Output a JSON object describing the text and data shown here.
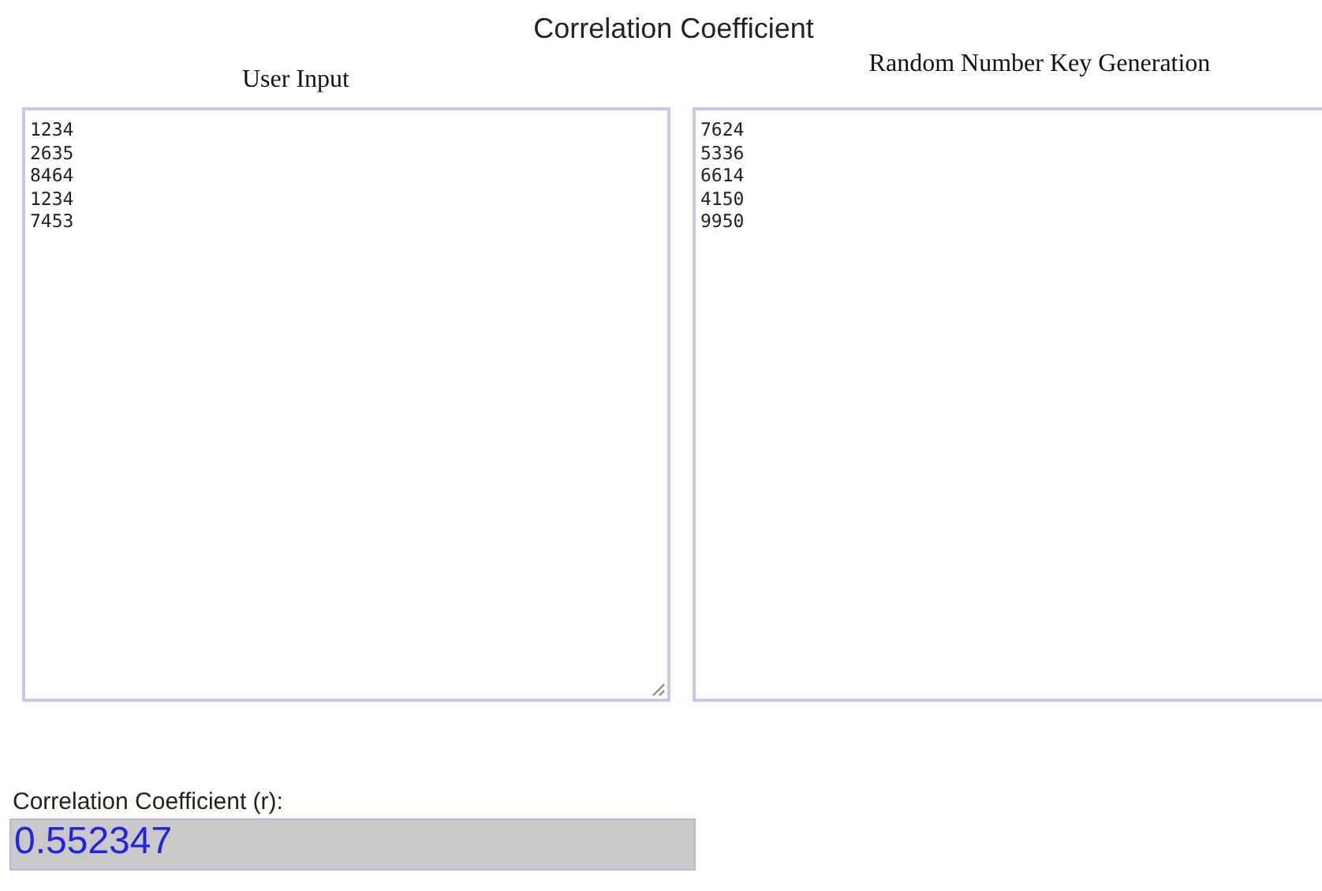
{
  "title": "Correlation Coefficient",
  "panels": [
    {
      "heading": "User Input",
      "values": [
        "1234",
        "2635",
        "8464",
        "1234",
        "7453"
      ]
    },
    {
      "heading": "Random Number Key Generation",
      "values": [
        "7624",
        "5336",
        "6614",
        "4150",
        "9950"
      ]
    }
  ],
  "result": {
    "label": "Correlation Coefficient (r):",
    "value": "0.552347"
  }
}
